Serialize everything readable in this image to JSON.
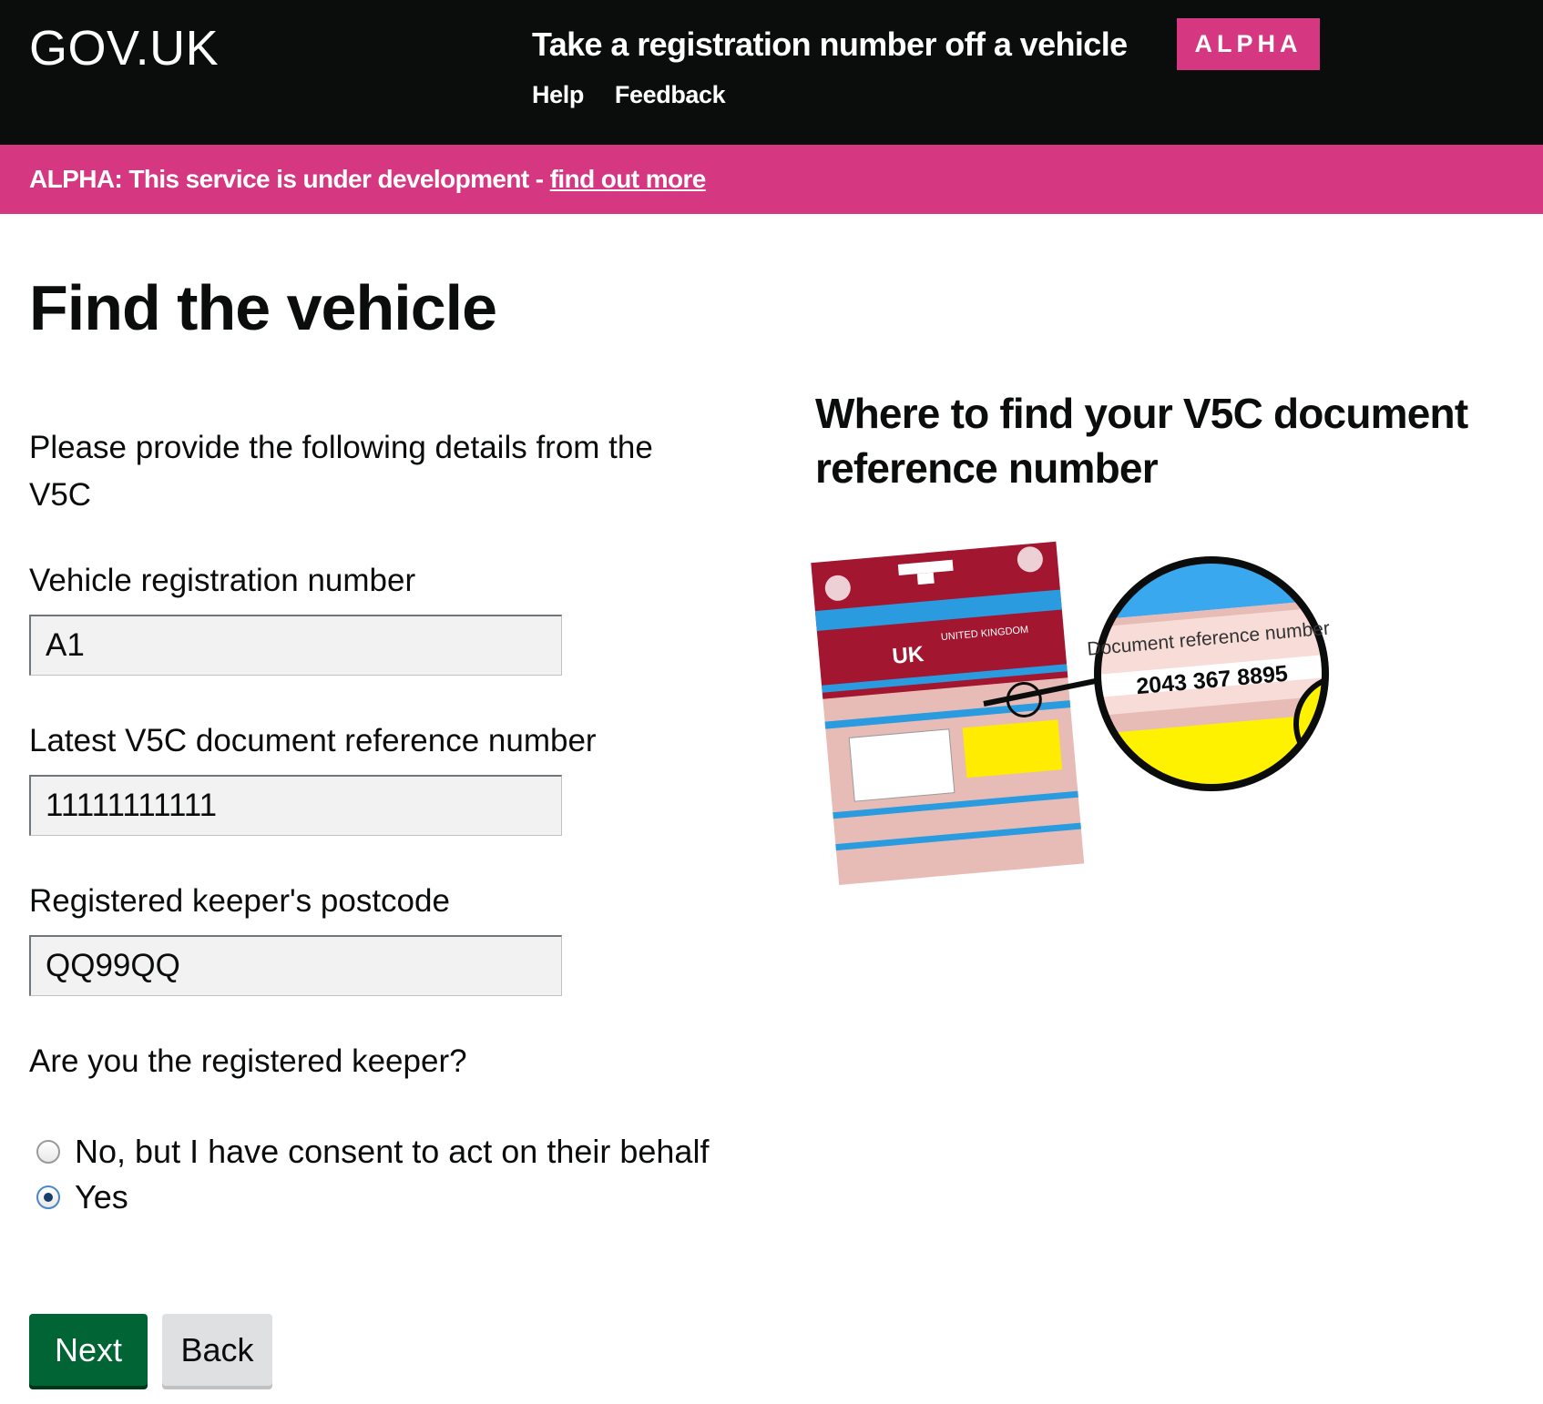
{
  "header": {
    "logo": "GOV.UK",
    "service_name": "Take a registration number off a vehicle",
    "phase_tag": "ALPHA",
    "nav": [
      {
        "label": "Help"
      },
      {
        "label": "Feedback"
      }
    ]
  },
  "phase_banner": {
    "text": "ALPHA: This service is under development - ",
    "link": "find out more"
  },
  "main": {
    "title": "Find the vehicle",
    "intro": "Please provide the following details from the V5C",
    "fields": [
      {
        "label": "Vehicle registration number",
        "value": "A1"
      },
      {
        "label": "Latest V5C document reference number",
        "value": "11111111111"
      },
      {
        "label": "Registered keeper's postcode",
        "value": "QQ99QQ"
      }
    ],
    "keeper_question": "Are you the registered keeper?",
    "radios": [
      {
        "label": "No, but I have consent to act on their behalf",
        "checked": false
      },
      {
        "label": "Yes",
        "checked": true
      }
    ],
    "buttons": {
      "next": "Next",
      "back": "Back"
    }
  },
  "sidebar": {
    "heading": "Where to find your V5C document reference number",
    "illustration": {
      "doc_country": "UNITED KINGDOM",
      "doc_country_short": "UK",
      "magnifier_label": "Document reference number",
      "magnifier_number": "2043 367 8895"
    }
  }
}
